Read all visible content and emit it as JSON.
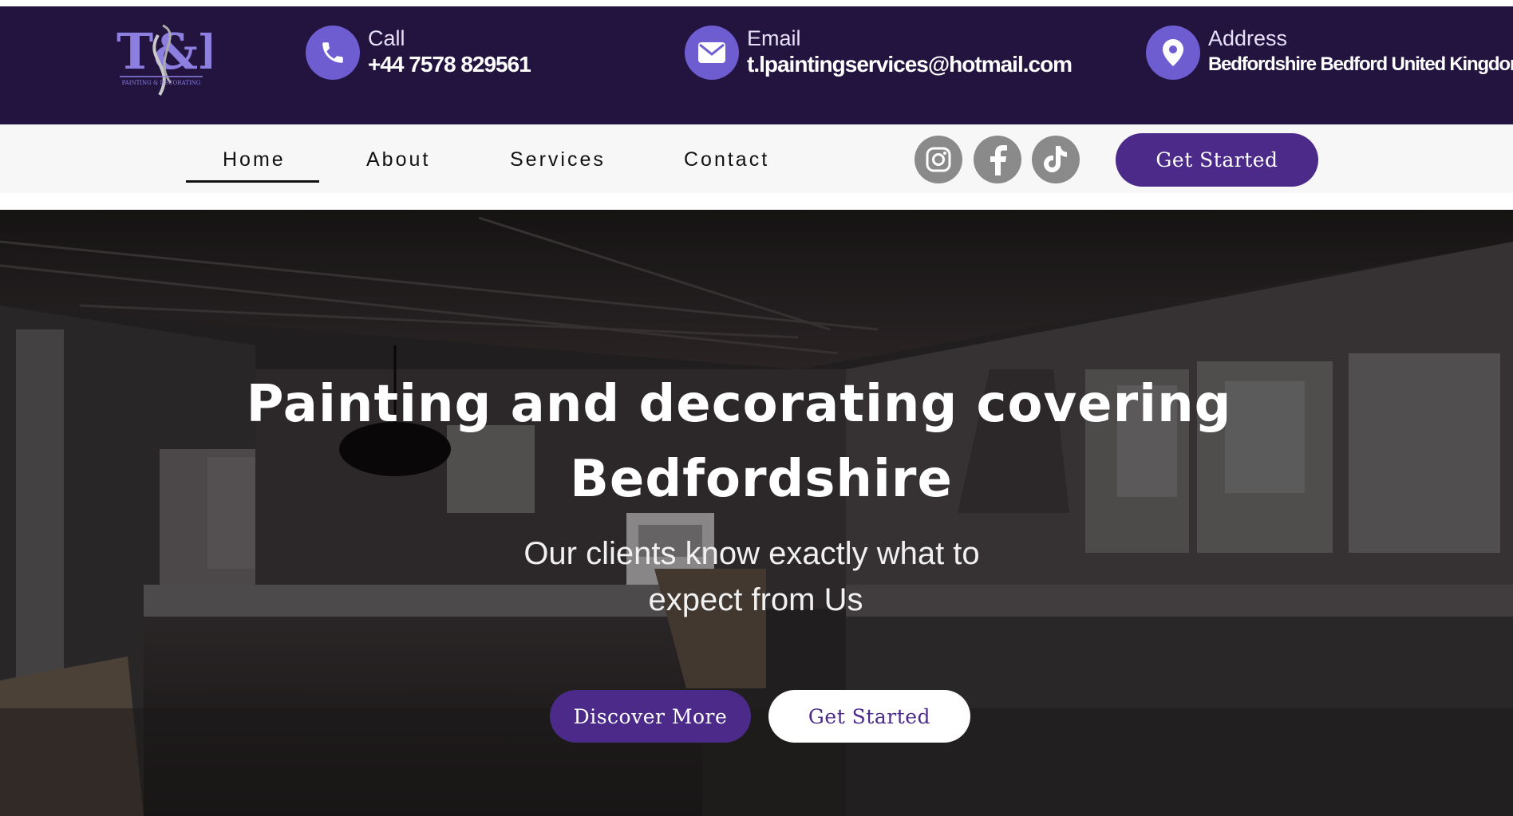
{
  "brand": {
    "logo_text": "T&L",
    "logo_tagline": "PAINTING & DECORATING",
    "accent_color": "#6d5dd0",
    "header_bg": "#22133f",
    "primary_button_color": "#4b2a8a"
  },
  "contact_bar": {
    "call": {
      "label": "Call",
      "value": "+44 7578 829561",
      "icon": "phone-icon"
    },
    "email": {
      "label": "Email",
      "value": "t.lpaintingservices@hotmail.com",
      "icon": "envelope-icon"
    },
    "address": {
      "label": "Address",
      "value": "Bedfordshire Bedford United Kingdom",
      "icon": "location-pin-icon"
    }
  },
  "nav": {
    "items": [
      {
        "label": "Home",
        "active": true
      },
      {
        "label": "About"
      },
      {
        "label": "Services"
      },
      {
        "label": "Contact"
      }
    ],
    "social": [
      "instagram-icon",
      "facebook-icon",
      "tiktok-icon"
    ],
    "cta_label": "Get Started"
  },
  "hero": {
    "title_line1": "Painting and decorating covering",
    "title_line2": "Bedfordshire",
    "subtitle_line1": "Our clients know exactly what to",
    "subtitle_line2": "expect  from Us",
    "primary_button": "Discover More",
    "secondary_button": "Get Started"
  }
}
